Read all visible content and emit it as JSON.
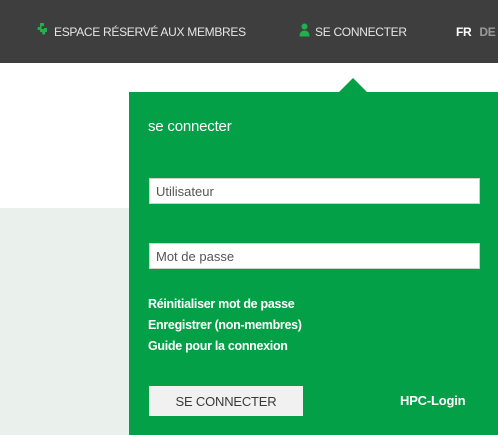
{
  "topbar": {
    "members_area_label": "ESPACE RÉSERVÉ AUX MEMBRES",
    "login_label": "SE CONNECTER",
    "lang_active": "FR",
    "lang_other": "DE"
  },
  "login_dropdown": {
    "title": "se connecter",
    "username_placeholder": "Utilisateur",
    "password_placeholder": "Mot de passe",
    "links": {
      "reset_password": "Réinitialiser mot de passe",
      "register": "Enregistrer (non-membres)",
      "guide": "Guide pour la connexion"
    },
    "submit_label": "SE CONNECTER",
    "hpc_login": "HPC-Login"
  },
  "colors": {
    "topbar_bg": "#3e3e3e",
    "brand_green": "#03a047",
    "side_panel_bg": "#eaf1ec"
  }
}
